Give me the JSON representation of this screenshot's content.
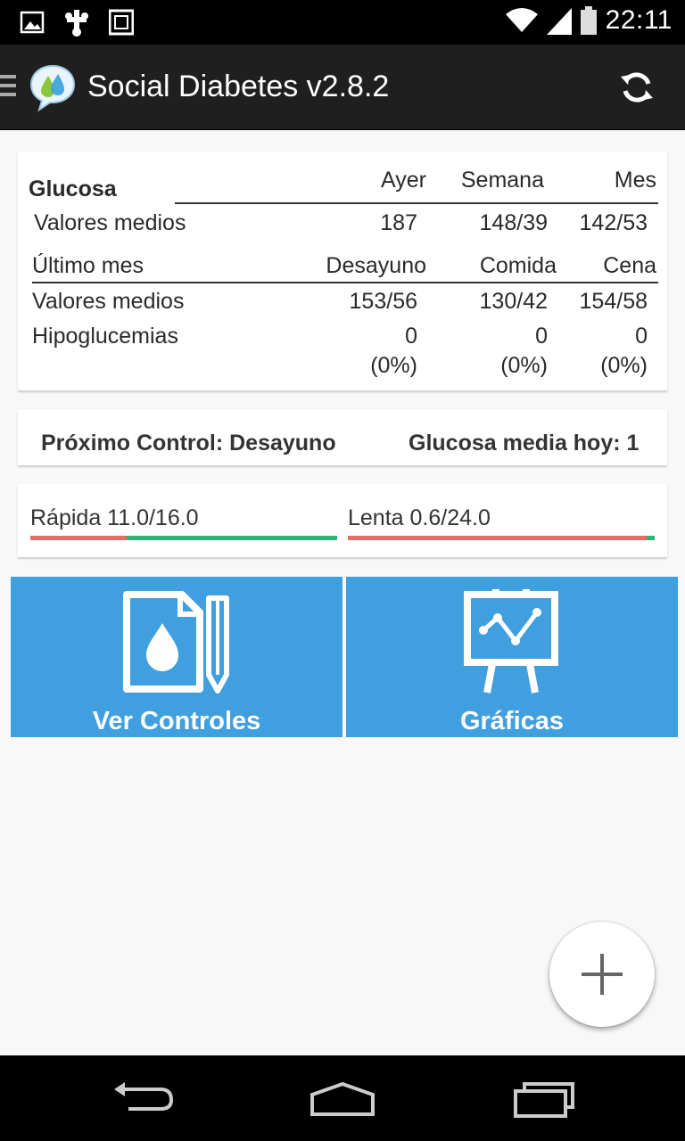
{
  "status_bar": {
    "time": "22:11",
    "left_icons": [
      "image-icon",
      "usb-icon",
      "screenshot-icon"
    ],
    "right_icons": [
      "wifi-icon",
      "signal-icon",
      "battery-icon"
    ]
  },
  "app_bar": {
    "title": "Social Diabetes v2.8.2"
  },
  "glucose": {
    "title": "Glucosa",
    "col_headers": [
      "Ayer",
      "Semana",
      "Mes"
    ],
    "row1_label": "Valores medios",
    "row1_values": [
      "187",
      "148/39",
      "142/53"
    ],
    "section2_title": "Último mes",
    "section2_headers": [
      "Desayuno",
      "Comida",
      "Cena"
    ],
    "row2_label": "Valores medios",
    "row2_values": [
      "153/56",
      "130/42",
      "154/58"
    ],
    "row3_label": "Hipoglucemias",
    "row3_values": [
      "0",
      "0",
      "0"
    ],
    "row3_percents": [
      "(0%)",
      "(0%)",
      "(0%)"
    ]
  },
  "control": {
    "next_control": "Próximo Control: Desayuno",
    "glucose_today": "Glucosa media hoy: 1"
  },
  "insulin": {
    "rapid_label": "Rápida 11.0/16.0",
    "rapid_fraction": 0.3125,
    "slow_label": "Lenta 0.6/24.0",
    "slow_fraction": 0.975,
    "colors": {
      "used": "#e76c65",
      "remaining": "#2fb378"
    }
  },
  "tiles": {
    "controls_label": "Ver Controles",
    "charts_label": "Gráficas",
    "color": "#409fdf"
  },
  "fab": {
    "icon": "plus-icon"
  },
  "nav": {
    "icons": [
      "back-icon",
      "home-icon",
      "recents-icon"
    ]
  }
}
